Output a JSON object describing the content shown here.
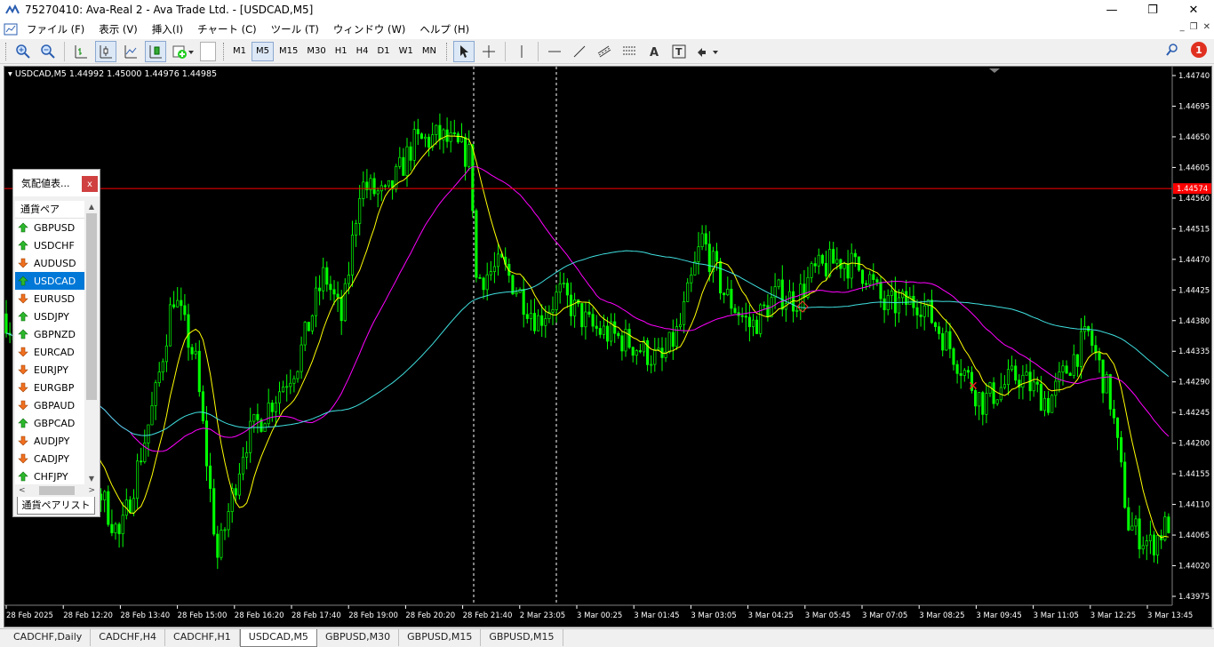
{
  "window": {
    "title": "75270410: Ava-Real 2 - Ava Trade Ltd. - [USDCAD,M5]",
    "controls": [
      "—",
      "❐",
      "✕"
    ]
  },
  "menu": [
    "ファイル (F)",
    "表示 (V)",
    "挿入(I)",
    "チャート (C)",
    "ツール (T)",
    "ウィンドウ (W)",
    "ヘルプ (H)"
  ],
  "mdi_controls": [
    "_",
    "❐",
    "✕"
  ],
  "toolbar": {
    "timeframes": [
      "M1",
      "M5",
      "M15",
      "M30",
      "H1",
      "H4",
      "D1",
      "W1",
      "MN"
    ],
    "active_timeframe": "M5",
    "alert_count": "1"
  },
  "chart": {
    "header": "USDCAD,M5  1.44992 1.45000 1.44976 1.44985",
    "current_price_label": "1.44574",
    "price_ticks": [
      "1.44740",
      "1.44695",
      "1.44650",
      "1.44605",
      "1.44560",
      "1.44515",
      "1.44470",
      "1.44425",
      "1.44380",
      "1.44335",
      "1.44290",
      "1.44245",
      "1.44200",
      "1.44155",
      "1.44110",
      "1.44065",
      "1.44020",
      "1.43975"
    ],
    "time_ticks": [
      "28 Feb 2025",
      "28 Feb 12:20",
      "28 Feb 13:40",
      "28 Feb 15:00",
      "28 Feb 16:20",
      "28 Feb 17:40",
      "28 Feb 19:00",
      "28 Feb 20:20",
      "28 Feb 21:40",
      "2 Mar 23:05",
      "3 Mar 00:25",
      "3 Mar 01:45",
      "3 Mar 03:05",
      "3 Mar 04:25",
      "3 Mar 05:45",
      "3 Mar 07:05",
      "3 Mar 08:25",
      "3 Mar 09:45",
      "3 Mar 11:05",
      "3 Mar 12:25",
      "3 Mar 13:45"
    ],
    "colors": {
      "candle": "#00ff00",
      "ma_fast": "#ffff00",
      "ma_mid": "#ff00ff",
      "ma_slow": "#40e0e0",
      "price_line": "#ff0000"
    }
  },
  "market_watch": {
    "title": "気配値表...",
    "close": "x",
    "column_header": "通貨ペア",
    "rows": [
      {
        "symbol": "GBPUSD",
        "dir": "up"
      },
      {
        "symbol": "USDCHF",
        "dir": "up"
      },
      {
        "symbol": "AUDUSD",
        "dir": "down"
      },
      {
        "symbol": "USDCAD",
        "dir": "up",
        "selected": true
      },
      {
        "symbol": "EURUSD",
        "dir": "down"
      },
      {
        "symbol": "USDJPY",
        "dir": "up"
      },
      {
        "symbol": "GBPNZD",
        "dir": "up"
      },
      {
        "symbol": "EURCAD",
        "dir": "down"
      },
      {
        "symbol": "EURJPY",
        "dir": "down"
      },
      {
        "symbol": "EURGBP",
        "dir": "down"
      },
      {
        "symbol": "GBPAUD",
        "dir": "down"
      },
      {
        "symbol": "GBPCAD",
        "dir": "up"
      },
      {
        "symbol": "AUDJPY",
        "dir": "down"
      },
      {
        "symbol": "CADJPY",
        "dir": "down"
      },
      {
        "symbol": "CHFJPY",
        "dir": "up"
      }
    ],
    "tab": "通貨ペアリスト"
  },
  "tabs": [
    "CADCHF,Daily",
    "CADCHF,H4",
    "CADCHF,H1",
    "USDCAD,M5",
    "GBPUSD,M30",
    "GBPUSD,M15",
    "GBPUSD,M15"
  ],
  "active_tab": "USDCAD,M5"
}
